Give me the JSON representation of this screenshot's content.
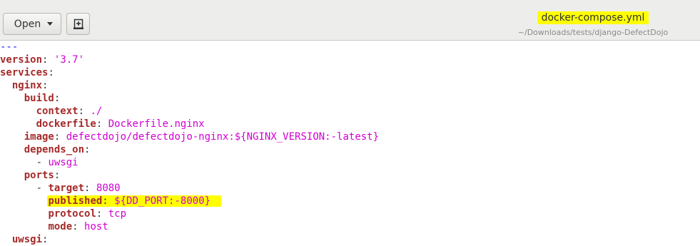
{
  "toolbar": {
    "open_label": "Open"
  },
  "window": {
    "title": "docker-compose.yml",
    "path": "~/Downloads/tests/django-DefectDojo"
  },
  "icons": {
    "open_arrow": "chevron-down-icon",
    "new_document": "new-document-icon"
  },
  "colors": {
    "key": "#a52a2a",
    "value": "#d100d1",
    "highlight": "#ffff00"
  },
  "code": [
    {
      "indent": "",
      "dash": "---"
    },
    {
      "indent": "",
      "key": "version",
      "value": "'3.7'"
    },
    {
      "indent": "",
      "key": "services",
      "value": ""
    },
    {
      "indent": "  ",
      "key": "nginx",
      "value": ""
    },
    {
      "indent": "    ",
      "key": "build",
      "value": ""
    },
    {
      "indent": "      ",
      "key": "context",
      "value": "./"
    },
    {
      "indent": "      ",
      "key": "dockerfile",
      "value": "Dockerfile.nginx"
    },
    {
      "indent": "    ",
      "key": "image",
      "value": "defectdojo/defectdojo-nginx:${NGINX_VERSION:-latest}"
    },
    {
      "indent": "    ",
      "key": "depends_on",
      "value": ""
    },
    {
      "indent": "      ",
      "item": "- ",
      "value": "uwsgi"
    },
    {
      "indent": "    ",
      "key": "ports",
      "value": ""
    },
    {
      "indent": "      ",
      "item": "- ",
      "key": "target",
      "value": "8080"
    },
    {
      "indent": "        ",
      "key": "published",
      "value": "${DD_PORT:-8000}",
      "highlight": true
    },
    {
      "indent": "        ",
      "key": "protocol",
      "value": "tcp"
    },
    {
      "indent": "        ",
      "key": "mode",
      "value": "host"
    },
    {
      "indent": "  ",
      "key": "uwsgi",
      "value": ""
    }
  ]
}
